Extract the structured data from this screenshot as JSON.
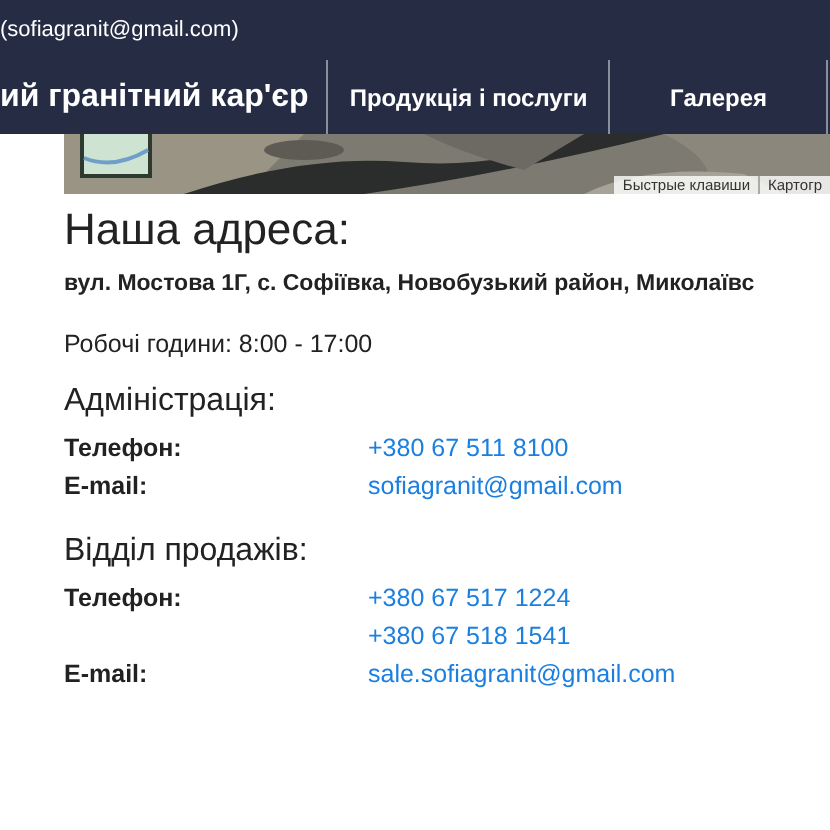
{
  "header": {
    "contact": "(sofiagranit@gmail.com)",
    "brand": "ий гранітний кар'єр",
    "nav": [
      {
        "label": "Продукція і послуги",
        "selected": false
      },
      {
        "label": "Галерея",
        "selected": false
      }
    ]
  },
  "map": {
    "kind": "picture",
    "attribution": [
      "Быстрые клавиши",
      "Картогр"
    ]
  },
  "address": {
    "title": "Наша адреса:",
    "street": "вул. Мостова 1Г, с. Софіївка, Новобузький район, Миколаївс",
    "hours": "Робочі години: 8:00 - 17:00"
  },
  "departments": [
    {
      "title": "Адміністрація:",
      "rows": [
        {
          "label": "Телефон:",
          "values": [
            "+380 67 511 8100"
          ]
        },
        {
          "label": "E-mail:",
          "values": [
            "sofiagranit@gmail.com"
          ]
        }
      ]
    },
    {
      "title": "Відділ продажів:",
      "rows": [
        {
          "label": "Телефон:",
          "values": [
            "+380 67 517 1224",
            "+380 67 518 1541"
          ]
        },
        {
          "label": "E-mail:",
          "values": [
            "sale.sofiagranit@gmail.com"
          ]
        }
      ]
    }
  ]
}
